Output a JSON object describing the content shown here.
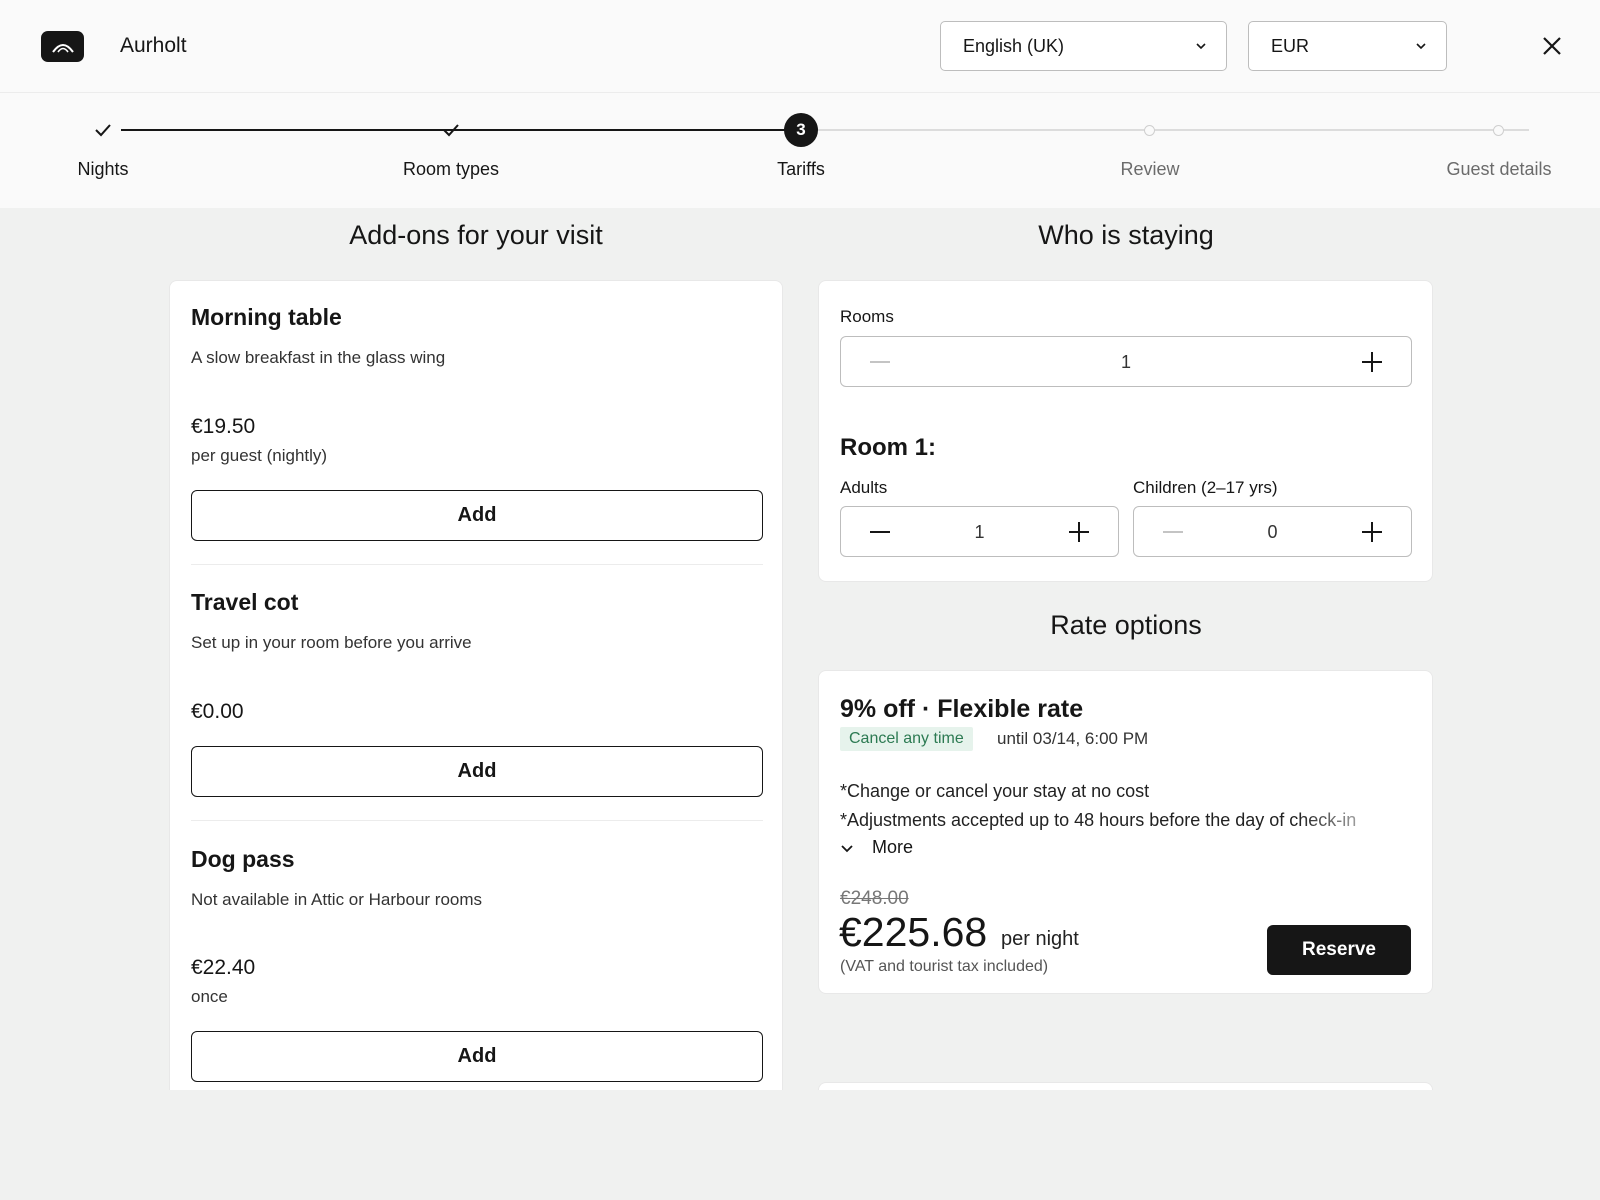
{
  "header": {
    "brand": "Aurholt",
    "language": "English (UK)",
    "currency": "EUR"
  },
  "stepper": {
    "current_number": "3",
    "steps": [
      {
        "label": "Nights",
        "state": "done"
      },
      {
        "label": "Room types",
        "state": "done"
      },
      {
        "label": "Tariffs",
        "state": "current"
      },
      {
        "label": "Review",
        "state": "todo"
      },
      {
        "label": "Guest details",
        "state": "todo"
      }
    ]
  },
  "addons": {
    "title": "Add-ons for your visit",
    "items": [
      {
        "name": "Morning table",
        "desc": "A slow breakfast in the glass wing",
        "price": "€19.50",
        "unit": "per guest (nightly)",
        "button": "Add"
      },
      {
        "name": "Travel cot",
        "desc": "Set up in your room before you arrive",
        "price": "€0.00",
        "unit": "",
        "button": "Add"
      },
      {
        "name": "Dog pass",
        "desc": "Not available in Attic or Harbour rooms",
        "price": "€22.40",
        "unit": "once",
        "button": "Add"
      }
    ]
  },
  "guests": {
    "title": "Who is staying",
    "rooms_label": "Rooms",
    "rooms_value": "1",
    "room_heading": "Room 1:",
    "adults_label": "Adults",
    "adults_value": "1",
    "children_label": "Children (2–17 yrs)",
    "children_value": "0"
  },
  "rates": {
    "title": "Rate options",
    "option": {
      "name": "9% off · Flexible rate",
      "badge": "Cancel any time",
      "until": "until 03/14, 6:00 PM",
      "lines": [
        "*Change or cancel your stay at no cost",
        "*Adjustments accepted up to 48 hours before the day of check-in"
      ],
      "more": "More",
      "old_price": "€248.00",
      "price": "€225.68",
      "per": "per night",
      "tax_note": "(VAT and tourist tax included)",
      "reserve": "Reserve"
    }
  },
  "colors": {
    "accent": "#161616",
    "badge_bg": "#e6f3ec",
    "badge_text": "#2c7a52",
    "page_bg": "#f0f1f0"
  }
}
